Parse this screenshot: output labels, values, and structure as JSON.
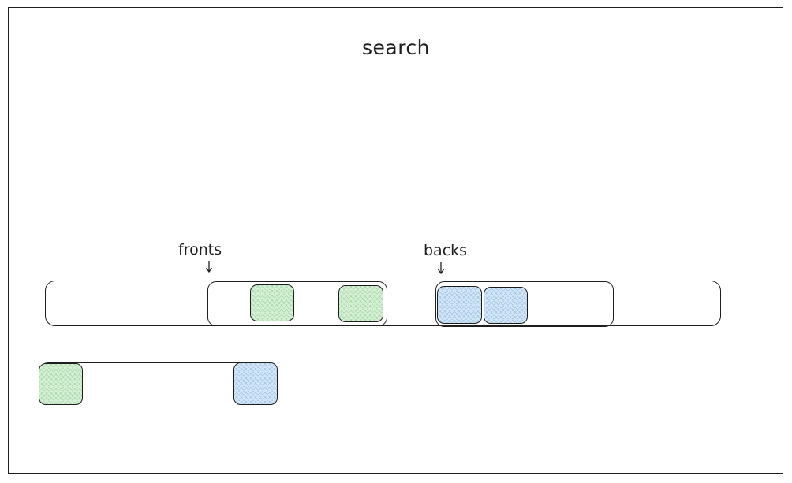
{
  "diagram": {
    "title": "search",
    "labels": {
      "fronts": "fronts",
      "backs": "backs"
    },
    "colors": {
      "stroke": "#1e1e1e",
      "green_fill": "#b2f2bb",
      "blue_fill": "#a5d8ff"
    },
    "icons": {
      "fronts_pointer": "arrow-down-icon",
      "backs_pointer": "arrow-down-icon"
    }
  }
}
